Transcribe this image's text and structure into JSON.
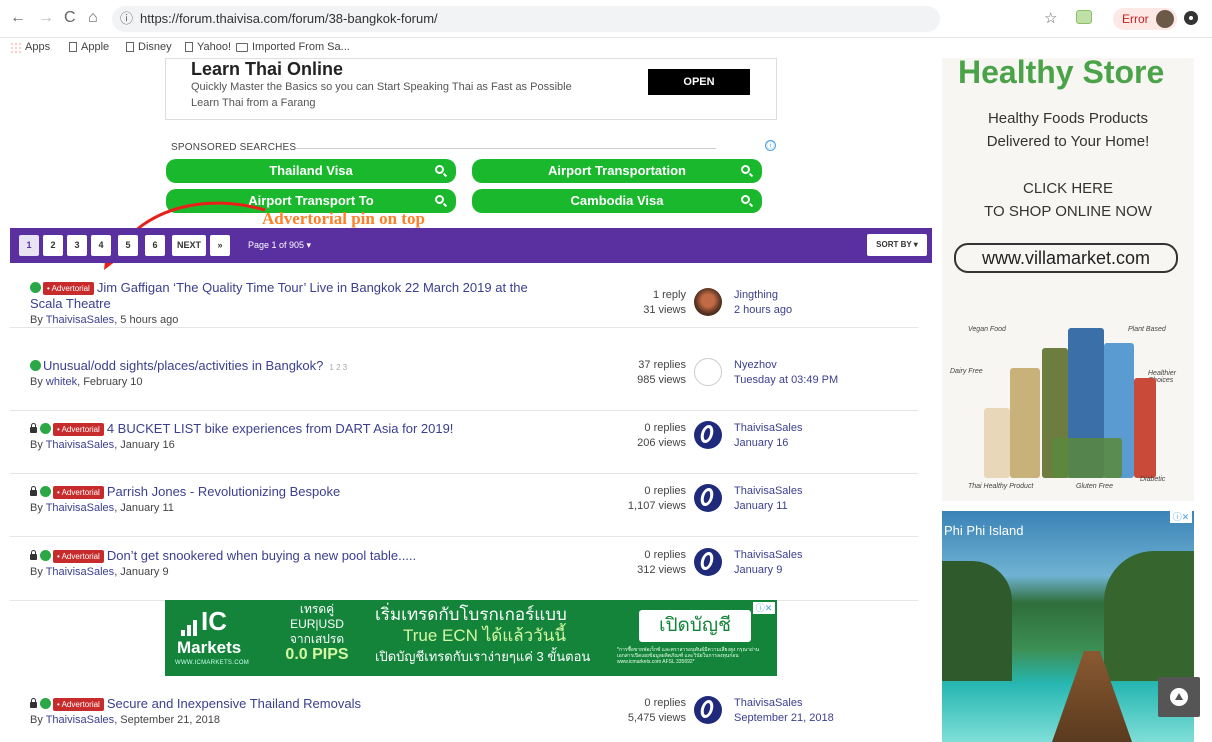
{
  "browser": {
    "url": "https://forum.thaivisa.com/forum/38-bangkok-forum/",
    "error_label": "Error",
    "bookmarks": [
      "Apps",
      "Apple",
      "Disney",
      "Yahoo!",
      "Imported From Sa..."
    ]
  },
  "top_ad": {
    "title": "Learn Thai Online",
    "line1": "Quickly Master the Basics so you can Start Speaking Thai as Fast as Possible",
    "line2": "Learn Thai from a Farang",
    "button": "OPEN"
  },
  "sponsored": {
    "heading": "SPONSORED SEARCHES",
    "info_icon": "ⓘ",
    "buttons": [
      "Thailand Visa",
      "Airport Transportation",
      "Airport Transport To",
      "Cambodia Visa"
    ]
  },
  "annotation": "Advertorial pin on top",
  "pager": {
    "pages": [
      "1",
      "2",
      "3",
      "4",
      "5",
      "6"
    ],
    "next": "NEXT",
    "last": "»",
    "page_of": "Page 1 of 905 ▾",
    "sort": "SORT BY ▾"
  },
  "topics": [
    {
      "badge": "• Advertorial",
      "title": "Jim Gaffigan ‘The Quality Time Tour’ Live in Bangkok 22 March 2019 at the Scala Theatre",
      "by_prefix": "By",
      "author": "ThaivisaSales",
      "date": ", 5 hours ago",
      "replies": "1 reply",
      "views": "31 views",
      "last_user": "Jingthing",
      "last_date": "2 hours ago"
    },
    {
      "title": "Unusual/odd sights/places/activities in Bangkok?",
      "mini_pages": "1  2  3",
      "by_prefix": "By",
      "author": "whitek",
      "date": ", February 10",
      "replies": "37 replies",
      "views": "985 views",
      "last_user": "Nyezhov",
      "last_date": "Tuesday at 03:49 PM"
    },
    {
      "badge": "• Advertorial",
      "title": "4 BUCKET LIST bike experiences from DART Asia for 2019!",
      "by_prefix": "By",
      "author": "ThaivisaSales",
      "date": ", January 16",
      "replies": "0 replies",
      "views": "206 views",
      "last_user": "ThaivisaSales",
      "last_date": "January 16"
    },
    {
      "badge": "• Advertorial",
      "title": "Parrish Jones - Revolutionizing Bespoke",
      "by_prefix": "By",
      "author": "ThaivisaSales",
      "date": ", January 11",
      "replies": "0 replies",
      "views": "1,107 views",
      "last_user": "ThaivisaSales",
      "last_date": "January 11"
    },
    {
      "badge": "• Advertorial",
      "title": "Don’t get snookered when buying a new pool table.....",
      "by_prefix": "By",
      "author": "ThaivisaSales",
      "date": ", January 9",
      "replies": "0 replies",
      "views": "312 views",
      "last_user": "ThaivisaSales",
      "last_date": "January 9"
    },
    {
      "badge": "• Advertorial",
      "title": "Secure and Inexpensive Thailand Removals",
      "by_prefix": "By",
      "author": "ThaivisaSales",
      "date": ", September 21, 2018",
      "replies": "0 replies",
      "views": "5,475 views",
      "last_user": "ThaivisaSales",
      "last_date": "September 21, 2018"
    }
  ],
  "icmarkets": {
    "logo_ic": "IC",
    "logo_markets": "Markets",
    "logo_url": "WWW.ICMARKETS.COM",
    "mid1": "เทรดคู่",
    "mid2": "EUR|USD",
    "mid3": "จากเสปรด",
    "pips": "0.0 PIPS",
    "main1": "เริ่มเทรดกับโบรกเกอร์แบบ",
    "ecn": "True ECN ได้แล้ววันนี้",
    "main3": "เปิดบัญชีเทรดกับเราง่ายๆแค่ 3 ขั้นตอน",
    "button": "เปิดบัญชี",
    "fine": "*การซื้อขายฟอเร็กซ์ และตราสารอนุพันธ์มีความเสี่ยงสูง กรุณาอ่านเอกสารเปิดเผยข้อมูลผลิตภัณฑ์ และวินัยในการลงทุนก่อน www.icmarkets.com AFSL 335692*",
    "adx": "ⓘ✕"
  },
  "right_ad1": {
    "brand": "Healthy Store",
    "line1": "Healthy Foods Products",
    "line2": "Delivered to Your Home!",
    "line3": "CLICK HERE",
    "line4": "TO SHOP ONLINE NOW",
    "url": "www.villamarket.com",
    "tags": [
      "Vegan Food",
      "Plant Based",
      "Dairy Free",
      "Healthier Choices",
      "Thai Healthy Product",
      "Gluten Free",
      "Diabetic"
    ]
  },
  "right_ad2": {
    "label": "Phi Phi Island",
    "adx": "ⓘ✕"
  },
  "colors": {
    "pager_bg": "#5a2fa0",
    "sponsored_green": "#1ab82c",
    "badge_red": "#c72b2b",
    "annotation_orange": "#ff7f27",
    "link_blue": "#3b3f8f"
  },
  "icons": [
    "back-icon",
    "forward-icon",
    "reload-icon",
    "home-icon",
    "info-icon",
    "star-icon",
    "search-icon",
    "pin-icon",
    "lock-icon",
    "scroll-top-icon"
  ]
}
